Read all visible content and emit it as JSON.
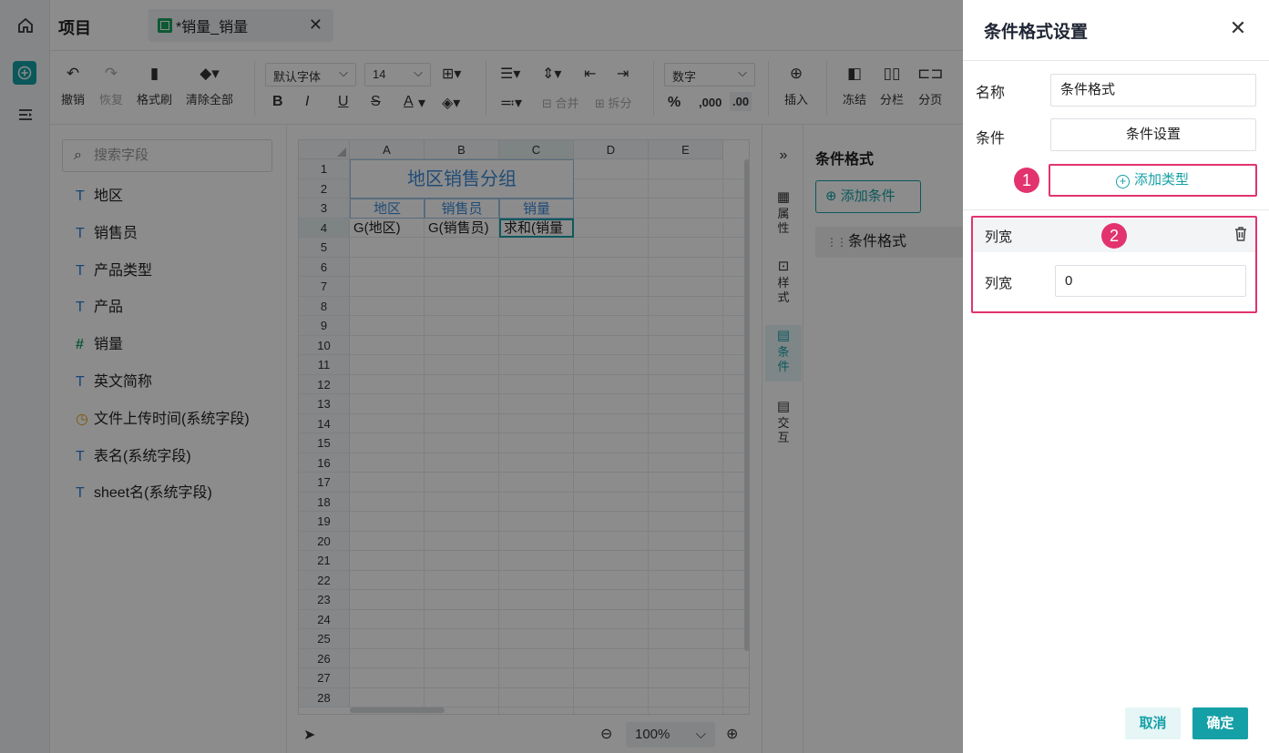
{
  "app": {
    "project_label": "项目",
    "file_tab": "*销量_销量",
    "icons": [
      "home-icon",
      "add-icon",
      "menu-icon",
      "close-icon"
    ]
  },
  "toolbar": {
    "undo": "撤销",
    "redo": "恢复",
    "format_brush": "格式刷",
    "clear_all": "清除全部",
    "font_family": "默认字体",
    "font_size": "14",
    "bold": "B",
    "italic": "I",
    "underline": "U",
    "strike": "S",
    "font_color": "A",
    "merge": "合并",
    "split": "拆分",
    "number_format": "数字",
    "percent": "%",
    "thousands": ",000",
    "decimal": ".00",
    "insert": "插入",
    "freeze": "冻结",
    "columns": "分栏",
    "page_break": "分页"
  },
  "fields": {
    "search_placeholder": "搜索字段",
    "items": [
      {
        "type": "T",
        "label": "地区"
      },
      {
        "type": "T",
        "label": "销售员"
      },
      {
        "type": "T",
        "label": "产品类型"
      },
      {
        "type": "T",
        "label": "产品"
      },
      {
        "type": "#",
        "label": "销量"
      },
      {
        "type": "T",
        "label": "英文简称"
      },
      {
        "type": "clock",
        "label": "文件上传时间(系统字段)"
      },
      {
        "type": "T",
        "label": "表名(系统字段)"
      },
      {
        "type": "T",
        "label": "sheet名(系统字段)"
      }
    ]
  },
  "sheet": {
    "columns": [
      "A",
      "B",
      "C",
      "D",
      "E"
    ],
    "rows": [
      "1",
      "2",
      "3",
      "4",
      "5",
      "6",
      "7",
      "8",
      "9",
      "10",
      "11",
      "12",
      "13",
      "14",
      "15",
      "16",
      "17",
      "18",
      "19",
      "20",
      "21",
      "22",
      "23",
      "24",
      "25",
      "26",
      "27",
      "28"
    ],
    "title": "地区销售分组",
    "headers": [
      "地区",
      "销售员",
      "销量"
    ],
    "row4": [
      "G(地区)",
      "G(销售员)",
      "求和(销量"
    ],
    "zoom": "100%"
  },
  "side_tabs": [
    "属性",
    "样式",
    "条件",
    "交互"
  ],
  "right_panel": {
    "title": "条件格式",
    "add_button": "添加条件",
    "item": "条件格式"
  },
  "dialog": {
    "title": "条件格式设置",
    "name_label": "名称",
    "name_value": "条件格式",
    "condition_label": "条件",
    "condition_button": "条件设置",
    "add_type": "添加类型",
    "section_title": "列宽",
    "width_label": "列宽",
    "width_value": "0",
    "badge1": "1",
    "badge2": "2",
    "cancel": "取消",
    "ok": "确定",
    "highlight_color": "#e2336f",
    "accent_color": "#14a0a6"
  }
}
